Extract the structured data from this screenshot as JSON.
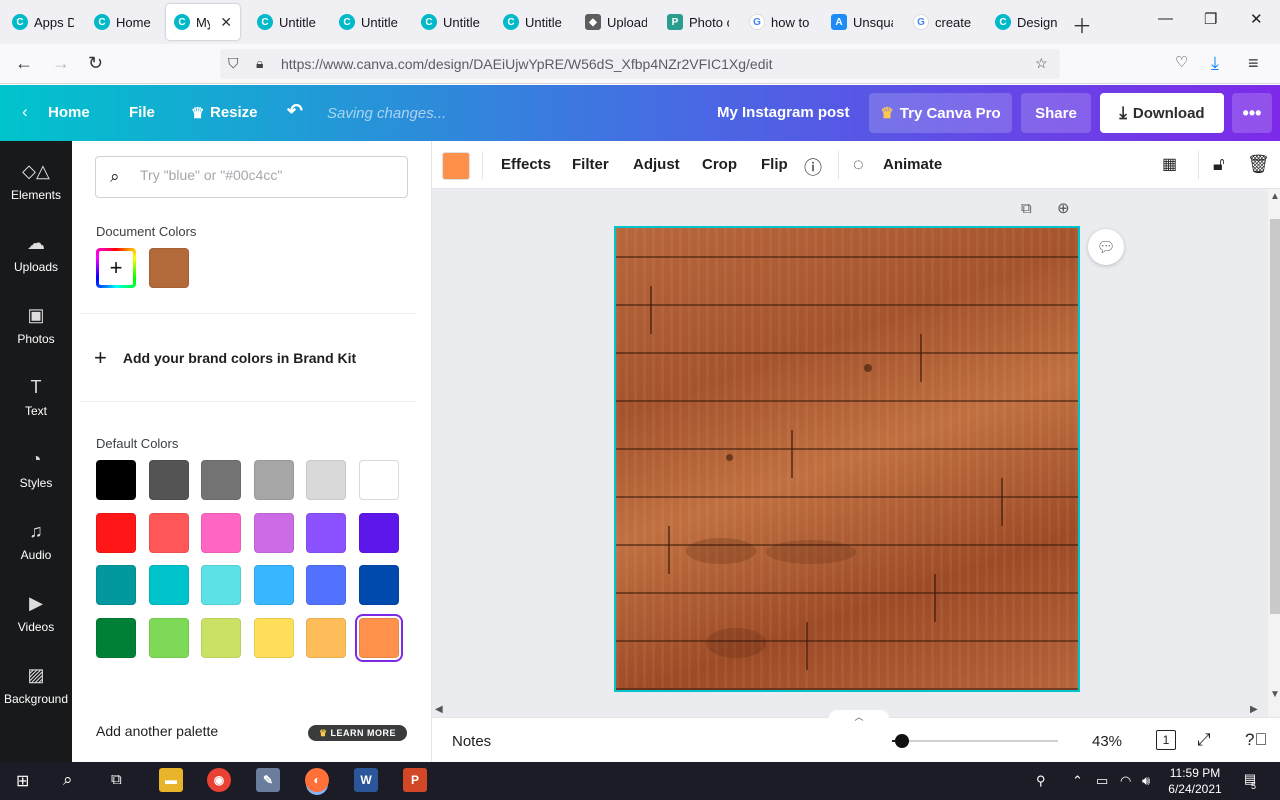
{
  "browser": {
    "tabs": [
      {
        "title": "Apps D",
        "icon": "canva-icon"
      },
      {
        "title": "Home",
        "icon": "canva-icon"
      },
      {
        "title": "My I",
        "icon": "canva-icon"
      },
      {
        "title": "Untitle",
        "icon": "canva-icon"
      },
      {
        "title": "Untitle",
        "icon": "canva-icon"
      },
      {
        "title": "Untitle",
        "icon": "canva-icon"
      },
      {
        "title": "Untitle",
        "icon": "canva-icon"
      },
      {
        "title": "Upload",
        "icon": "graduation-cap-icon"
      },
      {
        "title": "Photo c",
        "icon": "photo-icon"
      },
      {
        "title": "how to",
        "icon": "google-icon"
      },
      {
        "title": "Unsqua",
        "icon": "app-store-icon"
      },
      {
        "title": "create a",
        "icon": "google-icon"
      },
      {
        "title": "Design",
        "icon": "canva-icon"
      }
    ],
    "url": "https://www.canva.com/design/DAEiUjwYpRE/W56dS_Xfbp4NZr2VFIC1Xg/edit"
  },
  "header": {
    "home": "Home",
    "file": "File",
    "resize": "Resize",
    "saving": "Saving changes...",
    "design_title": "My Instagram post",
    "try_pro": "Try Canva Pro",
    "share": "Share",
    "download": "Download"
  },
  "rail": {
    "items": [
      {
        "label": "Elements",
        "icon": "elements-icon"
      },
      {
        "label": "Uploads",
        "icon": "upload-cloud-icon"
      },
      {
        "label": "Photos",
        "icon": "photos-icon"
      },
      {
        "label": "Text",
        "icon": "text-icon"
      },
      {
        "label": "Styles",
        "icon": "palette-icon"
      },
      {
        "label": "Audio",
        "icon": "music-note-icon"
      },
      {
        "label": "Videos",
        "icon": "video-icon"
      },
      {
        "label": "Background",
        "icon": "background-pattern-icon"
      }
    ]
  },
  "panel": {
    "search_placeholder": "Try \"blue\" or \"#00c4cc\"",
    "document_colors_title": "Document Colors",
    "document_colors": [
      "#b36a3a"
    ],
    "brand_kit": "Add your brand colors in Brand Kit",
    "default_colors_title": "Default Colors",
    "default_colors": [
      "#000000",
      "#545454",
      "#737373",
      "#a6a6a6",
      "#d9d9d9",
      "#ffffff",
      "#ff1616",
      "#ff5757",
      "#ff66c4",
      "#cb6ce6",
      "#8c52ff",
      "#5e17eb",
      "#03989e",
      "#00c2cb",
      "#5ce1e6",
      "#38b6ff",
      "#5271ff",
      "#004aad",
      "#008037",
      "#7ed957",
      "#c9e265",
      "#ffde59",
      "#ffbd59",
      "#ff914d"
    ],
    "selected_color": "#ff914d",
    "add_palette": "Add another palette",
    "learn_more": "LEARN MORE"
  },
  "toolbar": {
    "current_color": "#fd914b",
    "effects": "Effects",
    "filter": "Filter",
    "adjust": "Adjust",
    "crop": "Crop",
    "flip": "Flip",
    "animate": "Animate"
  },
  "bottom": {
    "notes": "Notes",
    "zoom": "43%",
    "zoom_fraction": 0.06,
    "page": "1"
  },
  "taskbar": {
    "time": "11:59 PM",
    "date": "6/24/2021",
    "notifications": "5"
  }
}
